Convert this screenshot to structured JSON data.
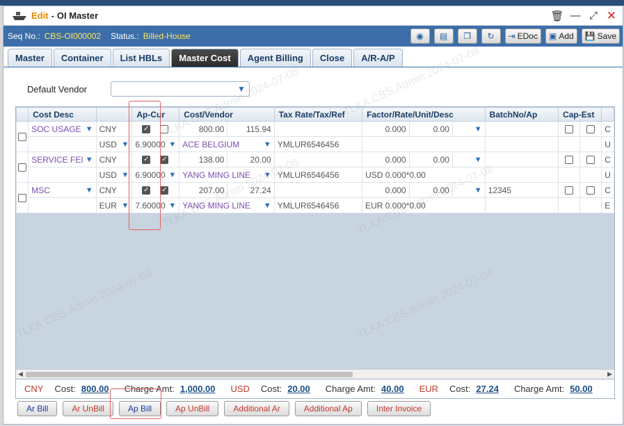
{
  "window": {
    "mode": "Edit",
    "title": "OI Master"
  },
  "seq": {
    "seq_label": "Seq No.:",
    "seq_value": "CBS-OI000002",
    "status_label": "Status.:",
    "status_value": "Billed-House"
  },
  "toolbar": {
    "edoc": "EDoc",
    "add": "Add",
    "save": "Save"
  },
  "tabs": [
    "Master",
    "Container",
    "List HBLs",
    "Master Cost",
    "Agent Billing",
    "Close",
    "A/R-A/P"
  ],
  "vendor": {
    "label": "Default Vendor",
    "value": ""
  },
  "grid": {
    "headers": [
      "Cost Desc",
      "Ap-Cur",
      "Cost/Vendor",
      "Tax Rate/Tax/Ref",
      "Factor/Rate/Unit/Desc",
      "BatchNo/Ap",
      "Cap-Est"
    ],
    "rows": [
      {
        "desc": "SOC USAGE",
        "cur1": "CNY",
        "cur2": "USD",
        "rate": "6.90000",
        "cost": "800.00",
        "cost2": "115.94",
        "vendor": "ACE BELGIUM",
        "ref": "YMLUR6546456",
        "factor": "0.000",
        "factor2": "0.00",
        "fdesc": "",
        "batch": "",
        "tail1": "C",
        "tail2": "U"
      },
      {
        "desc": "SERVICE FEI",
        "cur1": "CNY",
        "cur2": "USD",
        "rate": "6.90000",
        "cost": "138.00",
        "cost2": "20.00",
        "vendor": "YANG MING LINE",
        "ref": "YMLUR6546456",
        "factor": "0.000",
        "factor2": "0.00",
        "fdesc": "USD 0.000*0.00",
        "batch": "",
        "tail1": "C",
        "tail2": "U"
      },
      {
        "desc": "MSC",
        "cur1": "CNY",
        "cur2": "EUR",
        "rate": "7.60000",
        "cost": "207.00",
        "cost2": "27.24",
        "vendor": "YANG MING LINE",
        "ref": "YMLUR6546456",
        "factor": "0.000",
        "factor2": "0.00",
        "fdesc": "EUR 0.000*0.00",
        "batch": "12345",
        "tail1": "C",
        "tail2": "E"
      }
    ]
  },
  "summary": {
    "cost_label": "Cost:",
    "charge_label": "Charge Amt:",
    "groups": [
      {
        "cur": "CNY",
        "cost": "800.00",
        "charge": "1,000.00"
      },
      {
        "cur": "USD",
        "cost": "20.00",
        "charge": "40.00"
      },
      {
        "cur": "EUR",
        "cost": "27.24",
        "charge": "50.00"
      }
    ]
  },
  "buttons": [
    "Ar Bill",
    "Ar UnBill",
    "Ap Bill",
    "Ap UnBill",
    "Additional Ar",
    "Additional Ap",
    "Inter Invoice"
  ],
  "watermark": "TLKA.CBS.Admin 2024-07-08"
}
